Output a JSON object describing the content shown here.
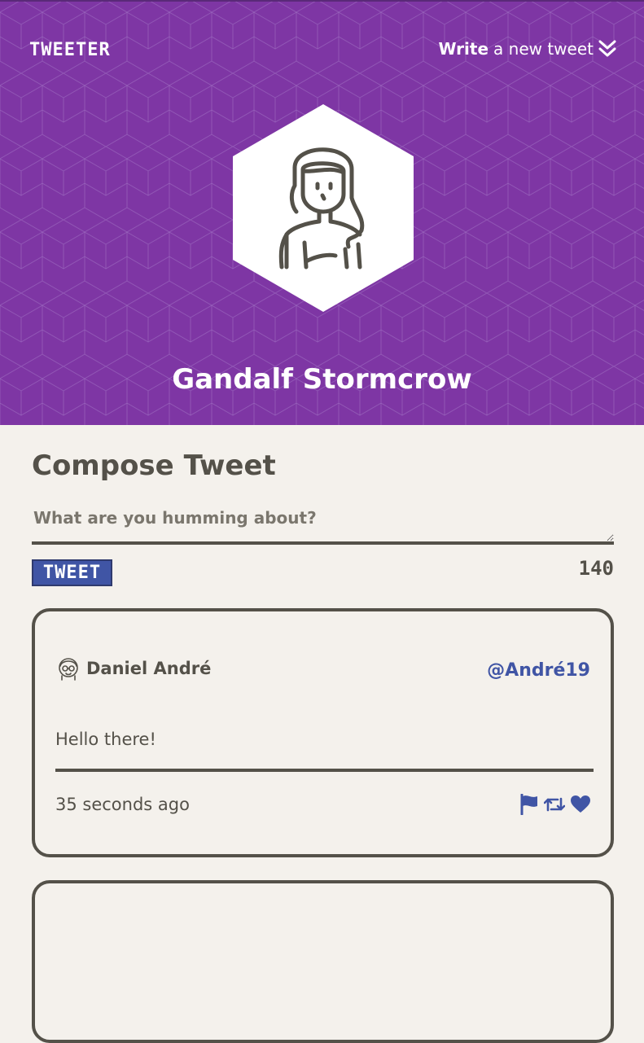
{
  "nav": {
    "brand": "TWEETER",
    "write_strong": "Write",
    "write_rest": "a new tweet"
  },
  "profile": {
    "name": "Gandalf Stormcrow"
  },
  "compose": {
    "title": "Compose Tweet",
    "placeholder": "What are you humming about?",
    "button_label": "TWEET",
    "char_count": "140"
  },
  "tweets": [
    {
      "author": "Daniel André",
      "handle": "@André19",
      "text": "Hello there!",
      "time": "35 seconds ago",
      "actions": [
        "flag-icon",
        "retweet-icon",
        "heart-icon"
      ]
    }
  ],
  "colors": {
    "header_bg": "#7e36a4",
    "page_bg": "#f4f1ec",
    "text": "#545149",
    "accent": "#4055a5"
  }
}
